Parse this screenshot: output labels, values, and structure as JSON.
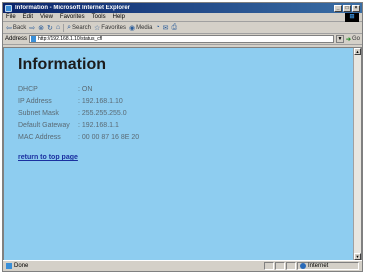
{
  "window": {
    "title": "Information - Microsoft Internet Explorer",
    "controls": [
      "_",
      "□",
      "×"
    ]
  },
  "menu": [
    "File",
    "Edit",
    "View",
    "Favorites",
    "Tools",
    "Help"
  ],
  "toolbar": {
    "back": "Back",
    "search": "Search",
    "favorites": "Favorites",
    "media": "Media"
  },
  "address": {
    "label": "Address",
    "url": "http://192.168.1.10/status_cfl",
    "go": "Go"
  },
  "page": {
    "title": "Information",
    "rows": [
      {
        "label": "DHCP",
        "value": ": ON"
      },
      {
        "label": "IP Address",
        "value": ": 192.168.1.10"
      },
      {
        "label": "Subnet Mask",
        "value": ": 255.255.255.0"
      },
      {
        "label": "Default Gateway",
        "value": ": 192.168.1.1"
      },
      {
        "label": "MAC Address",
        "value": ": 00 00 87 16 8E 20"
      }
    ],
    "link": "return to top page"
  },
  "status": {
    "text": "Done",
    "zone": "Internet"
  },
  "colors": {
    "page_background": "#8ecdf0",
    "link": "#1a30a0"
  }
}
